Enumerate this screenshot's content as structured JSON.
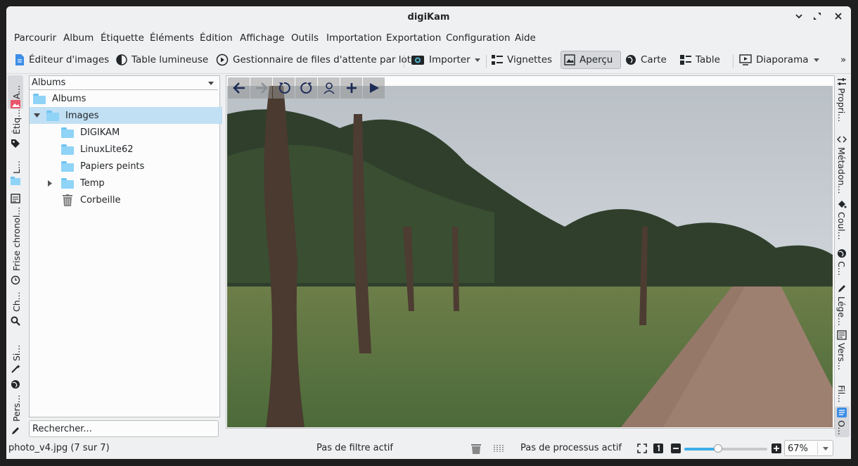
{
  "window": {
    "title": "digiKam"
  },
  "menu": [
    "Parcourir",
    "Album",
    "Étiquette",
    "Éléments",
    "Édition",
    "Affichage",
    "Outils",
    "Importation",
    "Exportation",
    "Configuration",
    "Aide"
  ],
  "toolbar": {
    "image_editor": "Éditeur d'images",
    "light_table": "Table lumineuse",
    "queue_manager": "Gestionnaire de files d'attente par lots",
    "import": "Importer",
    "thumbnails": "Vignettes",
    "preview": "Aperçu",
    "map": "Carte",
    "table": "Table",
    "slideshow": "Diaporama",
    "more": "»"
  },
  "left_tabs": {
    "albums": "A...",
    "labels": "Étiq...",
    "l": "L...",
    "timeline": "Frise chronol...",
    "search": "Ch...",
    "similar": "Si...",
    "people": "Pers..."
  },
  "right_tabs": {
    "properties": "Propri...",
    "metadata": "Métadon...",
    "colors": "Coul...",
    "c": "C...",
    "caption": "Lége...",
    "versions": "Vers...",
    "filters": "Fil...",
    "o": "O..."
  },
  "albums_panel": {
    "combo": "Albums",
    "tree": [
      {
        "label": "Albums"
      },
      {
        "label": "Images"
      },
      {
        "label": "DIGIKAM"
      },
      {
        "label": "LinuxLite62"
      },
      {
        "label": "Papiers peints"
      },
      {
        "label": "Temp"
      },
      {
        "label": "Corbeille"
      }
    ],
    "search_placeholder": "Rechercher..."
  },
  "status": {
    "file": "photo_v4.jpg (7 sur 7)",
    "filter": "Pas de filtre actif",
    "process": "Pas de processus actif",
    "zoom_text": "67%",
    "zoom_slider_fraction": 0.4
  }
}
